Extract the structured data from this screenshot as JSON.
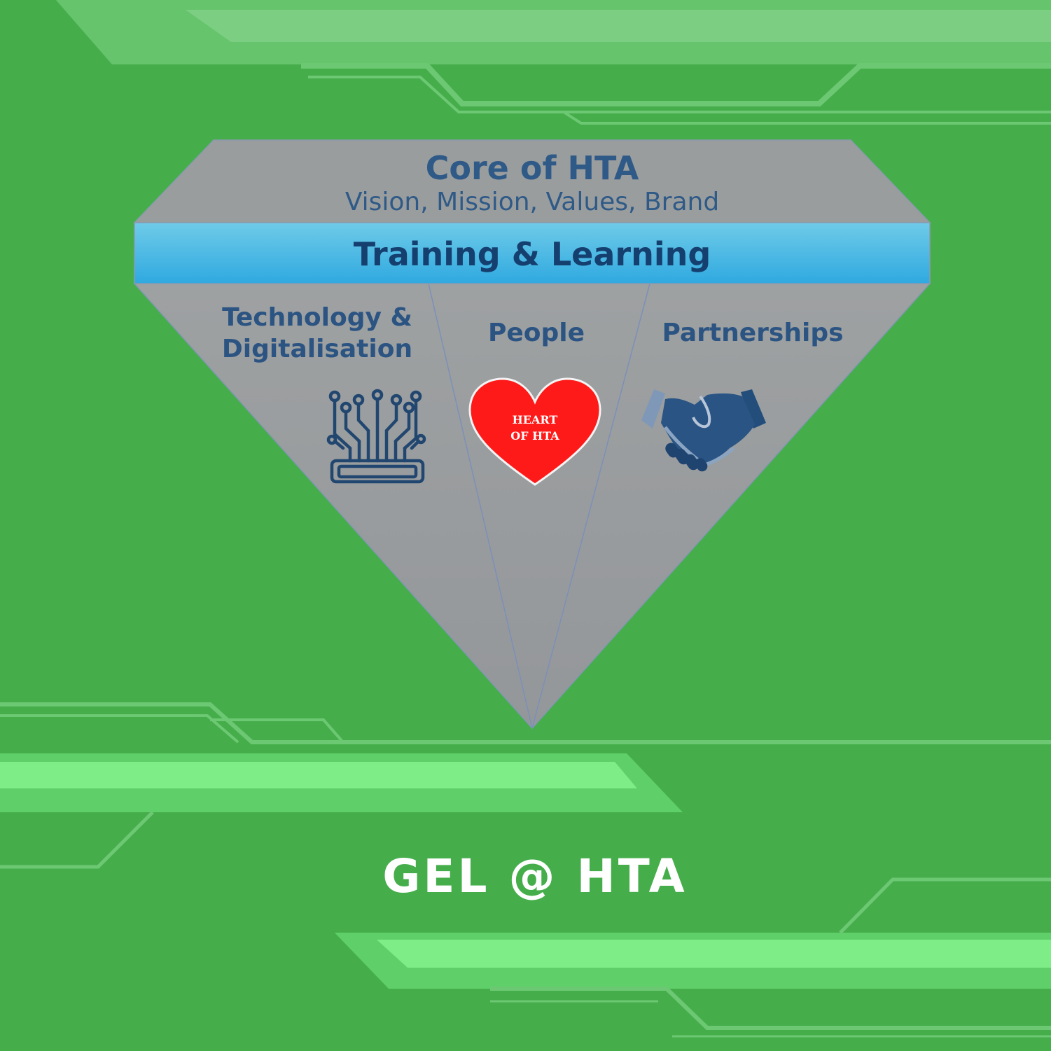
{
  "diamond": {
    "top_title": "Core of HTA",
    "top_subtitle": "Vision, Mission, Values, Brand",
    "band_label": "Training & Learning",
    "pillars": [
      {
        "line1": "Technology &",
        "line2": "Digitalisation",
        "icon": "circuit-icon"
      },
      {
        "line1": "People",
        "icon": "heart-icon"
      },
      {
        "line1": "Partnerships",
        "icon": "handshake-icon"
      }
    ],
    "heart_text_line1": "HEART",
    "heart_text_line2": "OF HTA"
  },
  "footer": {
    "title": "GEL @ HTA"
  },
  "colors": {
    "background": "#45ae4b",
    "panel_gray": "#9a9c9d",
    "text_navy": "#284f7c",
    "band_blue": "#3fb2e2",
    "heart_red": "#ff1a1a",
    "accent_light_green": "#7bea85"
  }
}
